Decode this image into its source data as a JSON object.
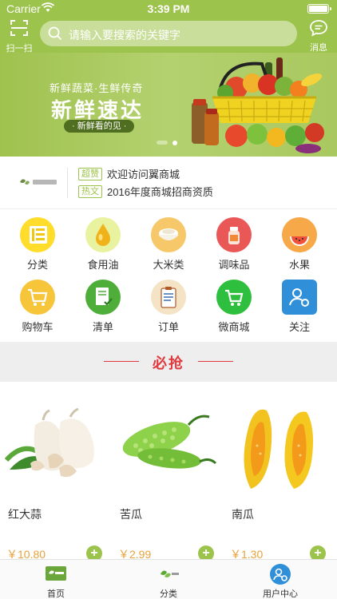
{
  "status": {
    "carrier": "Carrier",
    "time": "3:39 PM"
  },
  "header": {
    "scan_label": "扫一扫",
    "search_placeholder": "请输入要搜索的关键字",
    "message_label": "消息",
    "accent_color": "#9cc34b"
  },
  "banner": {
    "slogan": "新鲜蔬菜·生鲜传奇",
    "headline": "新鲜速达",
    "pill": "· 新鲜看的见 ·",
    "slide_count": 2,
    "active_slide": 2
  },
  "notice": {
    "items": [
      {
        "tag": "超赞",
        "text": "欢迎访问翼商城"
      },
      {
        "tag": "热文",
        "text": "2016年度商城招商资质"
      }
    ]
  },
  "categories": [
    {
      "label": "分类",
      "icon": "list-icon",
      "color": "#ffdd2a"
    },
    {
      "label": "食用油",
      "icon": "oil-drop-icon",
      "color": "#e9f29e"
    },
    {
      "label": "大米类",
      "icon": "rice-bowl-icon",
      "color": "#f6c86a"
    },
    {
      "label": "调味品",
      "icon": "seasoning-jar-icon",
      "color": "#e95757"
    },
    {
      "label": "水果",
      "icon": "watermelon-icon",
      "color": "#f7a94a"
    },
    {
      "label": "购物车",
      "icon": "shopping-cart-icon",
      "color": "#f7c53a"
    },
    {
      "label": "清单",
      "icon": "checklist-icon",
      "color": "#4fae3a"
    },
    {
      "label": "订单",
      "icon": "clipboard-order-icon",
      "color": "#f4e3c4"
    },
    {
      "label": "微商城",
      "icon": "micro-shop-cart-icon",
      "color": "#2fbf3f"
    },
    {
      "label": "关注",
      "icon": "user-settings-icon",
      "color": "#2f8fd8"
    }
  ],
  "section": {
    "title": "必抢",
    "accent_color": "#e0393e"
  },
  "products": [
    {
      "name": "红大蒜",
      "price": "￥10.80",
      "image": "garlic-image"
    },
    {
      "name": "苦瓜",
      "price": "￥2.99",
      "image": "bitter-melon-image"
    },
    {
      "name": "南瓜",
      "price": "￥1.30",
      "image": "pumpkin-image"
    }
  ],
  "tabs": [
    {
      "label": "首页",
      "icon": "home-logo-icon",
      "active": true
    },
    {
      "label": "分类",
      "icon": "category-logo-icon",
      "active": false
    },
    {
      "label": "用户中心",
      "icon": "user-center-icon",
      "active": false
    }
  ]
}
